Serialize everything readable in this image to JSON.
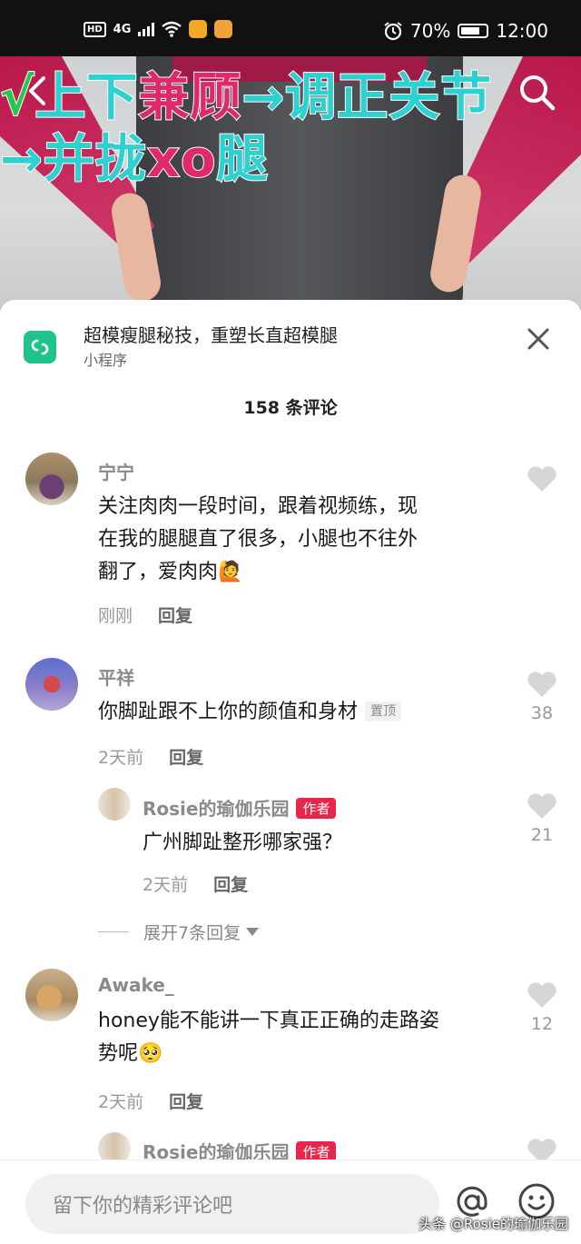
{
  "status_bar": {
    "hd": "HD",
    "network": "4G",
    "battery": "70%",
    "time": "12:00"
  },
  "video": {
    "title_line1_check": "√",
    "title_line1_a": "上下",
    "title_line1_b": "兼顾",
    "title_line1_c": "→调正关节",
    "title_line2_a": "→并拢",
    "title_line2_b": "xo",
    "title_line2_c": "腿"
  },
  "mini_program": {
    "title": "超模瘦腿秘技，重塑长直超模腿",
    "subtitle": "小程序"
  },
  "comment_count": "158 条评论",
  "comments": [
    {
      "user": "宁宁",
      "text_line1": "关注肉肉一段时间，跟着视频练，现",
      "text_line2": "在我的腿腿直了很多，小腿也不往外",
      "text_line3": "翻了，爱肉肉🙋",
      "time": "刚刚",
      "reply": "回复"
    },
    {
      "user": "平祥",
      "text": "你脚趾跟不上你的颜值和身材",
      "pin": "置顶",
      "time": "2天前",
      "reply": "回复",
      "likes": "38",
      "author_reply": {
        "user": "Rosie的瑜伽乐园",
        "badge": "作者",
        "text": "广州脚趾整形哪家强？",
        "time": "2天前",
        "reply": "回复",
        "likes": "21"
      },
      "expand": "展开7条回复"
    },
    {
      "user": "Awake_",
      "text_line1": "honey能不能讲一下真正正确的走路姿",
      "text_line2": "势呢🥺",
      "time": "2天前",
      "reply": "回复",
      "likes": "12",
      "author_reply": {
        "user": "Rosie的瑜伽乐园",
        "badge": "作者"
      }
    }
  ],
  "input": {
    "placeholder": "留下你的精彩评论吧"
  },
  "watermark": "头条 @Rosie的瑜伽乐园",
  "colors": {
    "accent_red": "#e8264b",
    "miniprogram_green": "#20c38a"
  }
}
